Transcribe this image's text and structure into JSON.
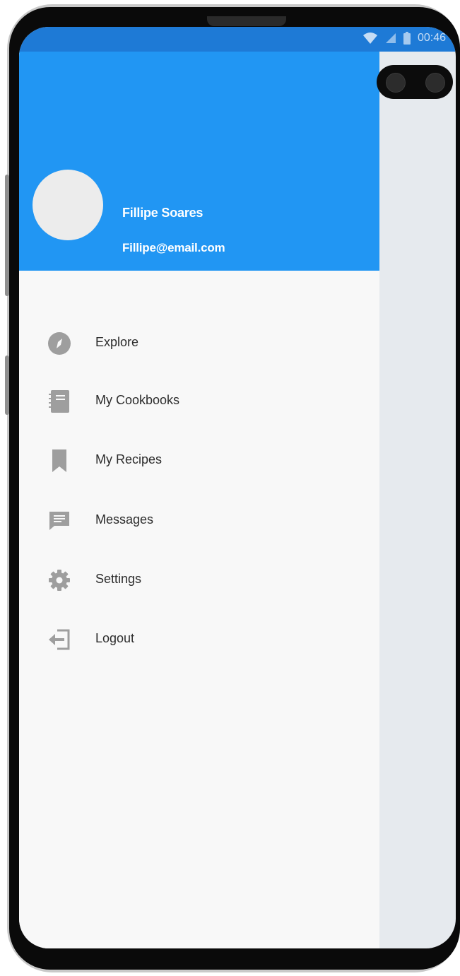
{
  "status_bar": {
    "time": "00:46",
    "icons": [
      "wifi-icon",
      "signal-icon",
      "battery-icon"
    ]
  },
  "profile": {
    "name": "Fillipe Soares",
    "email": "Fillipe@email.com"
  },
  "menu": [
    {
      "label": "Explore",
      "icon": "compass-icon"
    },
    {
      "label": "My Cookbooks",
      "icon": "notebook-icon"
    },
    {
      "label": "My Recipes",
      "icon": "bookmark-icon"
    },
    {
      "label": "Messages",
      "icon": "message-icon"
    },
    {
      "label": "Settings",
      "icon": "gear-icon"
    },
    {
      "label": "Logout",
      "icon": "logout-icon"
    }
  ],
  "colors": {
    "header": "#2196f3",
    "status_bar": "#1e7ad6",
    "drawer_bg": "#f8f8f8",
    "icon": "#9e9e9e",
    "scrim": "#e6eaee"
  }
}
